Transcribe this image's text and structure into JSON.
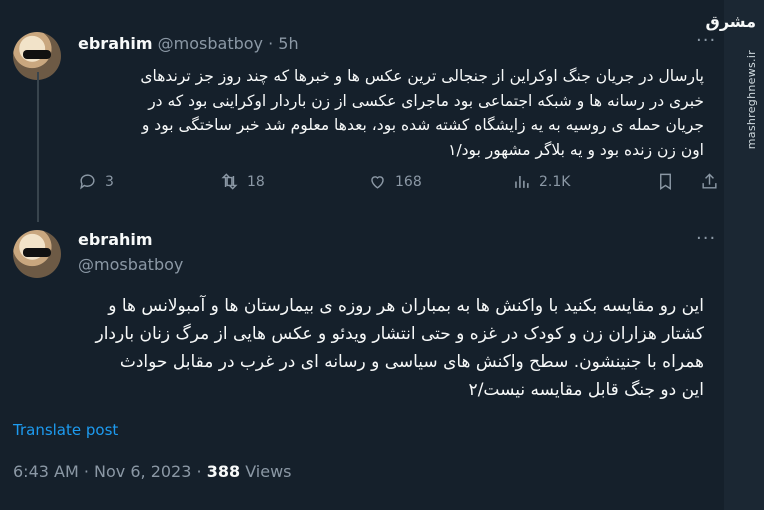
{
  "watermark": {
    "logo": "مشرق",
    "url": "mashreghnews.ir"
  },
  "tweet1": {
    "name": "ebrahim",
    "handle": "@mosbatboy",
    "dot": "·",
    "time": "5h",
    "lines": [
      "پارسال در جریان جنگ اوکراین از جنجالی ترین عکس ها و خبرها که چند روز جز ترندهای",
      "خبری در رسانه ها و شبکه اجتماعی بود ماجرای عکسی از زن باردار اوکراینی بود که در",
      "جریان حمله ی روسیه به یه زایشگاه کشته شده بود، بعدها معلوم شد خبر ساختگی بود و",
      "اون زن زنده بود و یه بلاگر مشهور بود/۱"
    ],
    "stats": {
      "replies": "3",
      "retweets": "18",
      "likes": "168",
      "views": "2.1K"
    }
  },
  "tweet2": {
    "name": "ebrahim",
    "handle": "@mosbatboy",
    "lines": [
      "این رو مقایسه بکنید با واکنش ها به بمباران هر روزه ی بیمارستان ها و آمبولانس ها و",
      "کشتار هزاران زن و کودک در غزه و حتی انتشار ویدئو و عکس هایی از مرگ زنان باردار",
      "همراه با جنینشون. سطح واکنش های سیاسی و رسانه ای در غرب در مقابل حوادث",
      "این دو جنگ قابل مقایسه نیست/۲"
    ],
    "translate": "Translate post",
    "time": "6:43 AM · Nov 6, 2023",
    "dot": "·",
    "views_count": "388",
    "views_label": "Views"
  }
}
